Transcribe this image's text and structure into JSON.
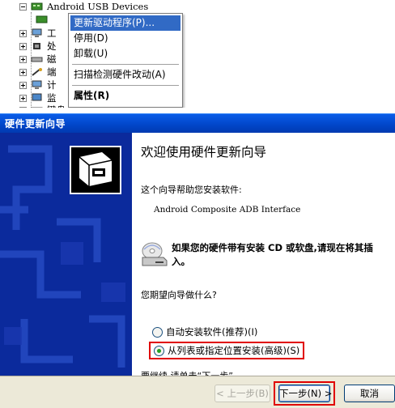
{
  "device_manager": {
    "device_category": "Android USB Devices",
    "context_menu": {
      "update_driver": "更新驱动程序(P)...",
      "disable": "停用(D)",
      "uninstall": "卸载(U)",
      "scan_hardware": "扫描检测硬件改动(A)",
      "properties": "属性(R)"
    },
    "partial_labels": [
      "工",
      "处",
      "磁",
      "端",
      "计",
      "监",
      "键盘"
    ]
  },
  "wizard": {
    "window_title": "硬件更新向导",
    "welcome_title": "欢迎使用硬件更新向导",
    "intro": "这个向导帮助您安装软件:",
    "device_name": "Android Composite ADB Interface",
    "cd_hint": "如果您的硬件带有安装 CD 或软盘,请现在将其插入。",
    "question": "您期望向导做什么?",
    "options": [
      {
        "label": "自动安装软件(推荐)(I)",
        "selected": false
      },
      {
        "label": "从列表或指定位置安装(高级)(S)",
        "selected": true
      }
    ],
    "continue_hint": "要继续,请单击“下一步”。",
    "buttons": {
      "back": "< 上一步(B)",
      "next": "下一步(N) >",
      "cancel": "取消"
    }
  },
  "colors": {
    "title_bar": "#0145c8",
    "sidebar": "#0b2a9c",
    "menu_highlight": "#316ac5",
    "annotation_red": "#e00000"
  }
}
